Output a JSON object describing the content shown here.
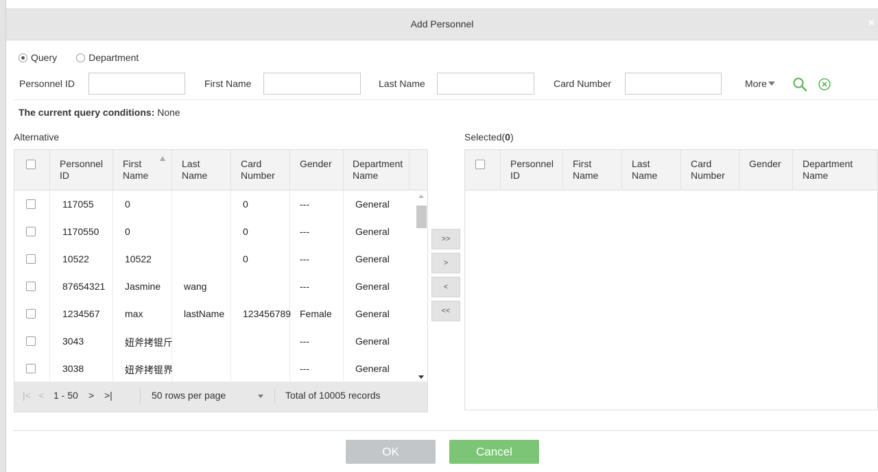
{
  "dialog": {
    "title": "Add Personnel",
    "close_glyph": "×"
  },
  "mode": {
    "options": [
      "Query",
      "Department"
    ],
    "selected": "Query"
  },
  "filters": {
    "personnel_id_label": "Personnel ID",
    "personnel_id_value": "",
    "first_name_label": "First Name",
    "first_name_value": "",
    "last_name_label": "Last Name",
    "last_name_value": "",
    "card_number_label": "Card Number",
    "card_number_value": "",
    "more_label": "More",
    "search_icon": "search-icon",
    "clear_icon": "clear-circle-icon"
  },
  "conditions": {
    "label": "The current query conditions:",
    "value": "None"
  },
  "alternative": {
    "label": "Alternative",
    "columns": [
      {
        "line1": "Personnel",
        "line2": "ID"
      },
      {
        "line1": "First",
        "line2": "Name"
      },
      {
        "line1": "Last",
        "line2": "Name"
      },
      {
        "line1": "Card",
        "line2": "Number"
      },
      {
        "line1": "Gender",
        "line2": ""
      },
      {
        "line1": "Department",
        "line2": "Name"
      }
    ],
    "rows": [
      [
        "117055",
        "0",
        "",
        "0",
        "---",
        "General"
      ],
      [
        "1170550",
        "0",
        "",
        "0",
        "---",
        "General"
      ],
      [
        "10522",
        "10522",
        "",
        "0",
        "---",
        "General"
      ],
      [
        "87654321",
        "Jasmine",
        "wang",
        "",
        "---",
        "General"
      ],
      [
        "1234567",
        "max",
        "lastName",
        "123456789",
        "Female",
        "General"
      ],
      [
        "3043",
        "妞斧拷锟斤",
        "",
        "",
        "---",
        "General"
      ],
      [
        "3038",
        "妞斧拷锟界",
        "",
        "",
        "---",
        "General"
      ]
    ],
    "pager": {
      "first": "|<",
      "prev": "<",
      "range": "1 - 50",
      "next": ">",
      "last": ">|",
      "rows_per_page": "50 rows per page",
      "total": "Total of 10005 records"
    }
  },
  "selected": {
    "label_prefix": "Selected(",
    "count": "0",
    "label_suffix": ")",
    "columns": [
      {
        "line1": "Personnel",
        "line2": "ID"
      },
      {
        "line1": "First",
        "line2": "Name"
      },
      {
        "line1": "Last",
        "line2": "Name"
      },
      {
        "line1": "Card",
        "line2": "Number"
      },
      {
        "line1": "Gender",
        "line2": ""
      },
      {
        "line1": "Department",
        "line2": "Name"
      }
    ]
  },
  "transfer": {
    "add_all": ">>",
    "add": ">",
    "remove": "<",
    "remove_all": "<<"
  },
  "buttons": {
    "ok": "OK",
    "cancel": "Cancel"
  }
}
